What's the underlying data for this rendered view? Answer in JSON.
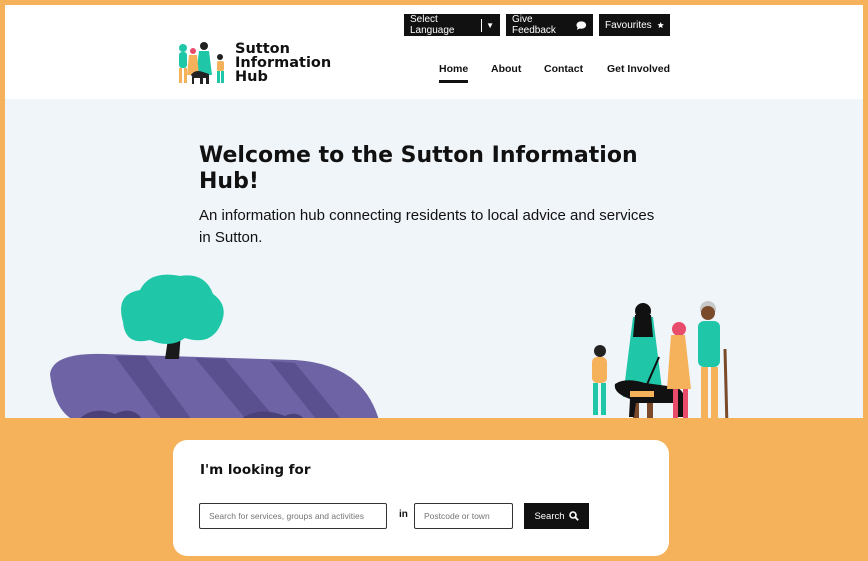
{
  "header": {
    "logo_lines": [
      "Sutton",
      "Information",
      "Hub"
    ],
    "utility": {
      "language_label": "Select Language",
      "language_arrow": "▼",
      "feedback_label": "Give Feedback",
      "favourites_label": "Favourites"
    },
    "nav": [
      {
        "label": "Home",
        "active": true
      },
      {
        "label": "About",
        "active": false
      },
      {
        "label": "Contact",
        "active": false
      },
      {
        "label": "Get Involved",
        "active": false
      }
    ]
  },
  "hero": {
    "title": "Welcome to the Sutton Information Hub!",
    "subtitle": "An information hub connecting residents to local advice and services in Sutton."
  },
  "search": {
    "heading": "I'm looking for",
    "service_placeholder": "Search for services, groups and activities",
    "in_label": "in",
    "postcode_placeholder": "Postcode or town",
    "button_label": "Search"
  },
  "colors": {
    "accent_orange": "#f6b25a",
    "teal": "#1fc7a8",
    "hero_bg": "#f0f5fa",
    "dark": "#111111"
  },
  "icons": [
    "feedback-bubble-icon",
    "star-icon",
    "search-icon"
  ]
}
